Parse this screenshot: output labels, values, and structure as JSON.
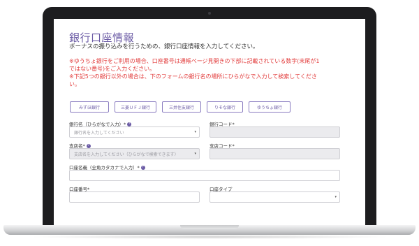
{
  "page": {
    "title": "銀行口座情報",
    "subtitle": "ボーナスの振り込みを行うための、銀行口座情報を入力してください。",
    "notice_lines": [
      "※ゆうちょ銀行をご利用の場合、口座番号は通帳ページ見開きの下部に記載されている数字(末尾が1",
      "ではない番号)をご入力ください。",
      "※下記5つの銀行以外の場合は、下のフォームの銀行名の場所にひらがなで入力して検索してくださ",
      "い。"
    ]
  },
  "bank_buttons": [
    "みずほ銀行",
    "三菱ＵＦＪ銀行",
    "三井住友銀行",
    "りそな銀行",
    "ゆうちょ銀行"
  ],
  "form": {
    "bank_name_label": "銀行名（ひらがなで入力）*",
    "bank_name_placeholder": "銀行名を入力してください",
    "bank_code_label": "銀行コード*",
    "branch_name_label": "支店名*",
    "branch_name_placeholder": "支店名を入力してください（ひらがなで検索できます）",
    "branch_code_label": "支店コード*",
    "account_holder_label": "口座名義（全角カタカナで入力）*",
    "account_number_label": "口座番号*",
    "account_type_label": "口座タイプ"
  },
  "icons": {
    "help": "?",
    "dropdown": "▾"
  },
  "colors": {
    "accent": "#6b5ba5",
    "notice": "#e23b3b"
  }
}
